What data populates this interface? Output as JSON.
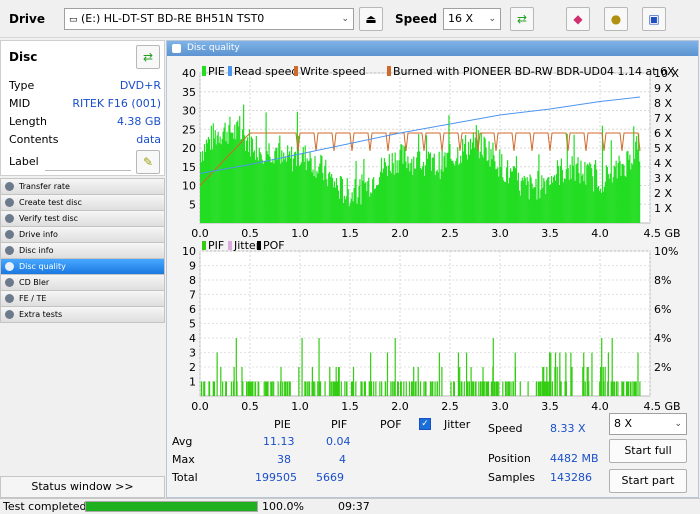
{
  "toolbar": {
    "drive_label": "Drive",
    "drive_value": "(E:)  HL-DT-ST BD-RE  BH51N TST0",
    "speed_label": "Speed",
    "speed_value": "16 X"
  },
  "disc": {
    "title": "Disc",
    "rows": [
      {
        "key": "Type",
        "value": "DVD+R"
      },
      {
        "key": "MID",
        "value": "RITEK F16 (001)"
      },
      {
        "key": "Length",
        "value": "4.38 GB"
      },
      {
        "key": "Contents",
        "value": "data"
      }
    ],
    "label_key": "Label"
  },
  "nav": {
    "items": [
      "Transfer rate",
      "Create test disc",
      "Verify test disc",
      "Drive info",
      "Disc info",
      "Disc quality",
      "CD Bler",
      "FE / TE",
      "Extra tests"
    ],
    "active_index": 5
  },
  "status_window": "Status window >>",
  "statusbar": {
    "text": "Test completed",
    "progress": 1.0,
    "percent": "100.0%",
    "time": "09:37"
  },
  "panel": {
    "title": "Disc quality"
  },
  "chart_data": [
    {
      "type": "bar",
      "legend": [
        "PIE",
        "Read speed",
        "Write speed",
        "Burned with PIONEER BD-RW   BDR-UD04 1.14 at 6X"
      ],
      "colors": {
        "pie": "#22dd22",
        "read": "#4d96f0",
        "write": "#d06a2a"
      },
      "x_ticks": [
        "0.0",
        "0.5",
        "1.0",
        "1.5",
        "2.0",
        "2.5",
        "3.0",
        "3.5",
        "4.0",
        "4.5 GB"
      ],
      "y_ticks_left": [
        "5",
        "10",
        "15",
        "20",
        "25",
        "30",
        "35",
        "40"
      ],
      "y_ticks_right": [
        "1 X",
        "2 X",
        "3 X",
        "4 X",
        "5 X",
        "6 X",
        "7 X",
        "8 X",
        "9 X",
        "10 X"
      ],
      "xlim": [
        0,
        4.5
      ],
      "ylim": [
        0,
        40
      ],
      "y2lim": [
        0,
        10
      ],
      "read_speed": {
        "x": [
          0.0,
          0.5,
          1.0,
          1.5,
          2.0,
          2.5,
          3.0,
          3.5,
          4.0,
          4.4
        ],
        "y": [
          3.3,
          3.9,
          4.6,
          5.3,
          6.0,
          6.6,
          7.2,
          7.6,
          8.1,
          8.4
        ]
      },
      "write_speed_level": 6.0
    },
    {
      "type": "bar",
      "legend": [
        "PIF",
        "Jitter",
        "POF"
      ],
      "colors": {
        "pif": "#33cc11",
        "jitter": "#ddaadd",
        "pof": "#000000"
      },
      "x_ticks": [
        "0.0",
        "0.5",
        "1.0",
        "1.5",
        "2.0",
        "2.5",
        "3.0",
        "3.5",
        "4.0",
        "4.5 GB"
      ],
      "y_ticks_left": [
        "1",
        "2",
        "3",
        "4",
        "5",
        "6",
        "7",
        "8",
        "9",
        "10"
      ],
      "y_ticks_right": [
        "2%",
        "4%",
        "6%",
        "8%",
        "10%"
      ],
      "xlim": [
        0,
        4.5
      ],
      "ylim": [
        0,
        10
      ]
    }
  ],
  "stats": {
    "headers": {
      "pie": "PIE",
      "pif": "PIF",
      "pof": "POF",
      "jitter": "Jitter"
    },
    "rows": [
      {
        "label": "Avg",
        "pie": "11.13",
        "pif": "0.04"
      },
      {
        "label": "Max",
        "pie": "38",
        "pif": "4"
      },
      {
        "label": "Total",
        "pie": "199505",
        "pif": "5669"
      }
    ],
    "speed_label": "Speed",
    "speed_value": "8.33 X",
    "position_label": "Position",
    "position_value": "4482 MB",
    "samples_label": "Samples",
    "samples_value": "143286",
    "speed_select": "8 X",
    "start_full": "Start full",
    "start_part": "Start part"
  }
}
